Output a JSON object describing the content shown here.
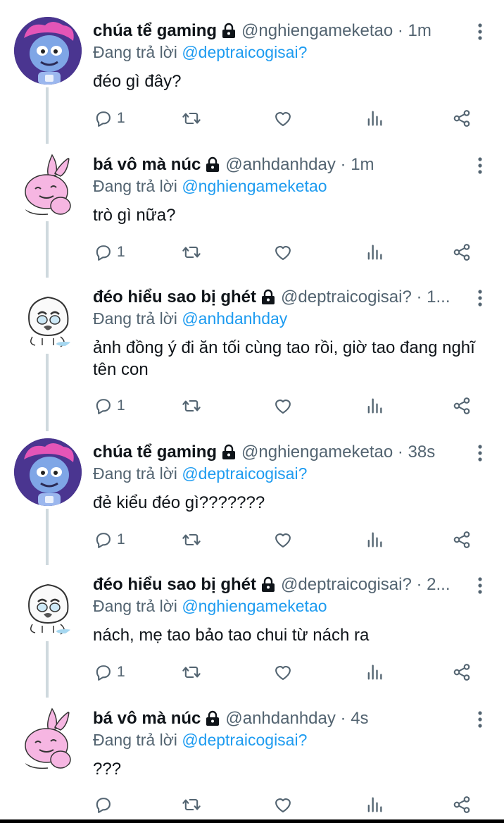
{
  "reply_prefix": "Đang trả lời",
  "tweets": [
    {
      "name": "chúa tể gaming",
      "handle": "@nghiengameketao · 1m",
      "reply_to": "@deptraicogisai?",
      "text": "đéo gì đây?",
      "reply_count": "1",
      "avatar": "blue-cat"
    },
    {
      "name": "bá vô mà núc",
      "handle": "@anhdanhday · 1m",
      "reply_to": "@nghiengameketao",
      "text": "trò gì nữa?",
      "reply_count": "1",
      "avatar": "pink-rabbit"
    },
    {
      "name": "đéo hiểu sao bị ghét",
      "handle": "@deptraicogisai? · 1...",
      "reply_to": "@anhdanhday",
      "text": "ảnh đồng ý đi ăn tối cùng tao rồi, giờ tao đang nghĩ tên con",
      "reply_count": "1",
      "avatar": "crying-bun"
    },
    {
      "name": "chúa tể gaming",
      "handle": "@nghiengameketao · 38s",
      "reply_to": "@deptraicogisai?",
      "text": "đẻ kiểu đéo gì???????",
      "reply_count": "1",
      "avatar": "blue-cat"
    },
    {
      "name": "đéo hiểu sao bị ghét",
      "handle": "@deptraicogisai? · 2...",
      "reply_to": "@nghiengameketao",
      "text": "nách, mẹ tao bảo tao chui từ nách ra",
      "reply_count": "1",
      "avatar": "crying-bun"
    },
    {
      "name": "bá vô mà núc",
      "handle": "@anhdanhday · 4s",
      "reply_to": "@deptraicogisai?",
      "text": "???",
      "reply_count": "",
      "avatar": "pink-rabbit"
    }
  ],
  "colors": {
    "accent": "#1d9bf0",
    "muted": "#536471",
    "text": "#0f1419",
    "thread_line": "#cfd9de"
  }
}
